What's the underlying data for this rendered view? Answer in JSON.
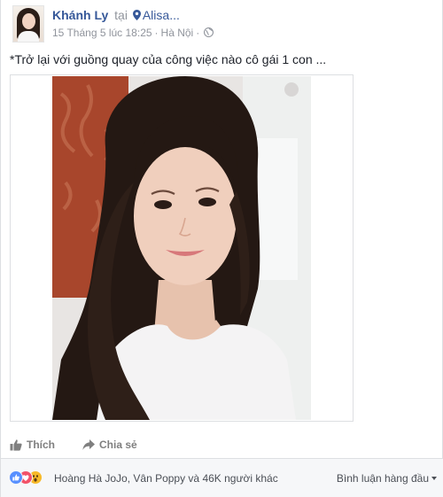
{
  "post": {
    "author": "Khánh Ly",
    "at_word": "tại",
    "place": "Alisa...",
    "timestamp": "15 Tháng 5 lúc 18:25",
    "location": "Hà Nội",
    "privacy_icon": "globe-icon",
    "caption": "*Trở lại với guồng quay của công việc nào cô gái 1 con ...",
    "photo_icon": "selfie-photo"
  },
  "actions": {
    "like_label": "Thích",
    "share_label": "Chia sẻ"
  },
  "reactions": {
    "icons": [
      "like-reaction-icon",
      "love-reaction-icon",
      "wow-reaction-icon"
    ],
    "summary": "Hoàng Hà JoJo, Vân Poppy và 46K người khác",
    "sort_label": "Bình luận hàng đầu"
  },
  "colors": {
    "link": "#365899",
    "meta": "#90949c",
    "like_blue": "#5890ff",
    "love_red": "#f25268",
    "wow_yellow": "#f7b928"
  }
}
